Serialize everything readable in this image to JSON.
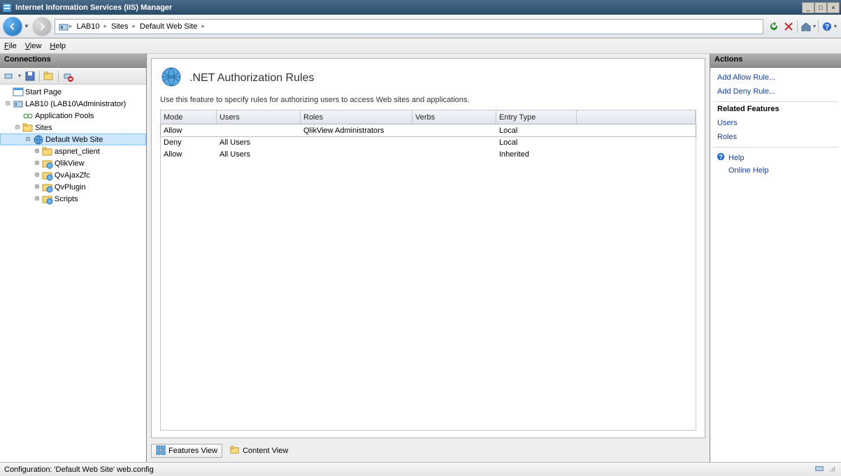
{
  "window": {
    "title": "Internet Information Services (IIS) Manager"
  },
  "breadcrumb": {
    "node1": "LAB10",
    "node2": "Sites",
    "node3": "Default Web Site"
  },
  "menu": {
    "file": "File",
    "view": "View",
    "help": "Help"
  },
  "connections": {
    "title": "Connections",
    "tree": {
      "start_page": "Start Page",
      "server": "LAB10 (LAB10\\Administrator)",
      "app_pools": "Application Pools",
      "sites": "Sites",
      "default_site": "Default Web Site",
      "aspnet_client": "aspnet_client",
      "qlikview": "QlikView",
      "qvajaxzfc": "QvAjaxZfc",
      "qvplugin": "QvPlugin",
      "scripts": "Scripts"
    }
  },
  "feature": {
    "title": ".NET Authorization Rules",
    "description": "Use this feature to specify rules for authorizing users to access Web sites and applications.",
    "columns": {
      "mode": "Mode",
      "users": "Users",
      "roles": "Roles",
      "verbs": "Verbs",
      "entry": "Entry Type"
    },
    "rows": [
      {
        "mode": "Allow",
        "users": "",
        "roles": "QlikView Administrators",
        "verbs": "",
        "entry": "Local"
      },
      {
        "mode": "Deny",
        "users": "All Users",
        "roles": "",
        "verbs": "",
        "entry": "Local"
      },
      {
        "mode": "Allow",
        "users": "All Users",
        "roles": "",
        "verbs": "",
        "entry": "Inherited"
      }
    ]
  },
  "viewtabs": {
    "features": "Features View",
    "content": "Content View"
  },
  "actions": {
    "title": "Actions",
    "add_allow": "Add Allow Rule...",
    "add_deny": "Add Deny Rule...",
    "related": "Related Features",
    "users": "Users",
    "roles": "Roles",
    "help": "Help",
    "online_help": "Online Help"
  },
  "status": {
    "text": "Configuration: 'Default Web Site' web.config"
  }
}
